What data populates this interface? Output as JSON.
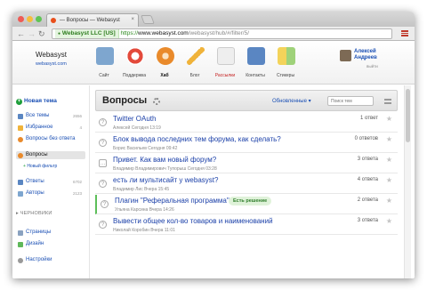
{
  "browser": {
    "tab_title": "— Вопросы — Webasyst",
    "tab_close": "×",
    "url_ev": "Webasyst LLC [US]",
    "url_https": "https://",
    "url_host": "www.webasyst.com",
    "url_path": "/webasyst/hub/#/filter/5/",
    "colors": {
      "close": "#ee5b55",
      "minimize": "#f5bd3c",
      "zoom": "#5fc455"
    }
  },
  "header": {
    "account_name": "Webasyst",
    "account_site": "webasyst.com",
    "apps": [
      {
        "label": "Сайт",
        "icon": "site-icon",
        "color": "#7ea6cf"
      },
      {
        "label": "Поддержка",
        "icon": "lifebuoy-icon",
        "color": "#e34a3b"
      },
      {
        "label": "Хаб",
        "icon": "hub-icon",
        "color": "#e98a2b"
      },
      {
        "label": "Блог",
        "icon": "pencil-icon",
        "color": "#f0b33a"
      },
      {
        "label": "Рассылки",
        "icon": "mailer-icon",
        "color": "#d9d9d9"
      },
      {
        "label": "Контакты",
        "icon": "contacts-icon",
        "color": "#5a86c2"
      },
      {
        "label": "Стикеры",
        "icon": "stickies-icon",
        "color": "#f3d35a"
      }
    ],
    "user_name_first": "Алексей",
    "user_name_last": "Андреев",
    "user_logout": "выйти"
  },
  "sidebar": {
    "new_topic": "Новая тема",
    "items_top": [
      {
        "label": "Все темы",
        "count": "2656",
        "icon": "list-icon",
        "color": "#5a86c2"
      },
      {
        "label": "Избранное",
        "count": "4",
        "icon": "star-icon",
        "color": "#f0b33a"
      },
      {
        "label": "Вопросы без ответа",
        "count": "",
        "icon": "question-icon",
        "color": "#e98a2b"
      },
      {
        "label": "Вопросы",
        "count": "",
        "icon": "question-icon",
        "color": "#e98a2b"
      }
    ],
    "add_filter": "Новый фильтр",
    "items_mid": [
      {
        "label": "Ответы",
        "count": "6702",
        "icon": "reply-icon",
        "color": "#5a86c2"
      },
      {
        "label": "Авторы",
        "count": "2123",
        "icon": "users-icon",
        "color": "#7ea6cf"
      }
    ],
    "drafts_section": "ЧЕРНОВИКИ",
    "items_bottom": [
      {
        "label": "Страницы",
        "icon": "pages-icon",
        "color": "#8aa2c0"
      },
      {
        "label": "Дизайн",
        "icon": "design-icon",
        "color": "#5fb85a"
      },
      {
        "label": "Настройки",
        "icon": "settings-icon",
        "color": "#999999"
      }
    ]
  },
  "main": {
    "title": "Вопросы",
    "sort_label": "Обновленные ▾",
    "search_placeholder": "Поиск тем",
    "solved_badge": "Есть решение",
    "topics": [
      {
        "title": "Twitter OAuth",
        "meta": "Алексей Сегодня 13:19",
        "count": "1 ответ",
        "solved": false
      },
      {
        "title": "Блок вывода последних тем форума, как сделать?",
        "meta": "Борис Васильев Сегодня 09:42",
        "count": "0 ответов",
        "solved": false
      },
      {
        "title": "Привет. Как вам новый форум?",
        "meta": "Владимир Владимирович Тупорыш Сегодня 03:28",
        "count": "3 ответа",
        "solved": false
      },
      {
        "title": "есть ли мультисайт у webasyst?",
        "meta": "Владимир Лис Вчера 15:45",
        "count": "4 ответа",
        "solved": false
      },
      {
        "title": "Плагин \"Реферальная программа\"",
        "meta": "Ульяна Карсина Вчера 14:26",
        "count": "2 ответа",
        "solved": true
      },
      {
        "title": "Вывести общее кол-во товаров и наименований",
        "meta": "Николай Коробин Вчера 11:01",
        "count": "3 ответа",
        "solved": false
      }
    ]
  }
}
